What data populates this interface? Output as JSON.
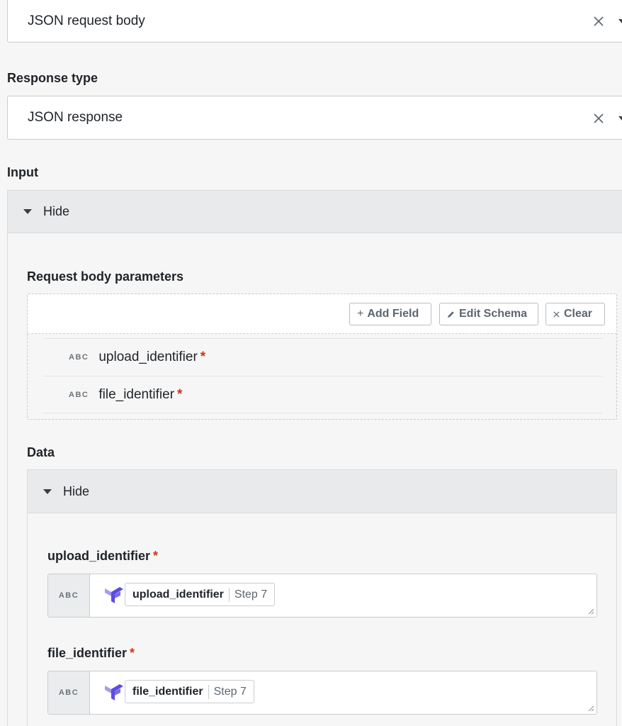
{
  "request_type": {
    "value": "JSON request body"
  },
  "response_type": {
    "label": "Response type",
    "value": "JSON response"
  },
  "input": {
    "label": "Input",
    "toggle_label": "Hide",
    "request_body": {
      "title": "Request body parameters",
      "buttons": {
        "add_field": "Add Field",
        "edit_schema": "Edit Schema",
        "clear": "Clear"
      },
      "type_tag": "ABC",
      "params": [
        {
          "name": "upload_identifier",
          "required_mark": "*"
        },
        {
          "name": "file_identifier",
          "required_mark": "*"
        }
      ]
    },
    "data": {
      "label": "Data",
      "toggle_label": "Hide",
      "fields": [
        {
          "label": "upload_identifier",
          "required_mark": "*",
          "type_tag": "ABC",
          "pill_name": "upload_identifier",
          "pill_step": "Step 7"
        },
        {
          "label": "file_identifier",
          "required_mark": "*",
          "type_tag": "ABC",
          "pill_name": "file_identifier",
          "pill_step": "Step 7"
        }
      ]
    }
  },
  "colors": {
    "required": "#d1331b",
    "logo_primary": "#5b4ce0",
    "logo_secondary": "#a89af0"
  }
}
